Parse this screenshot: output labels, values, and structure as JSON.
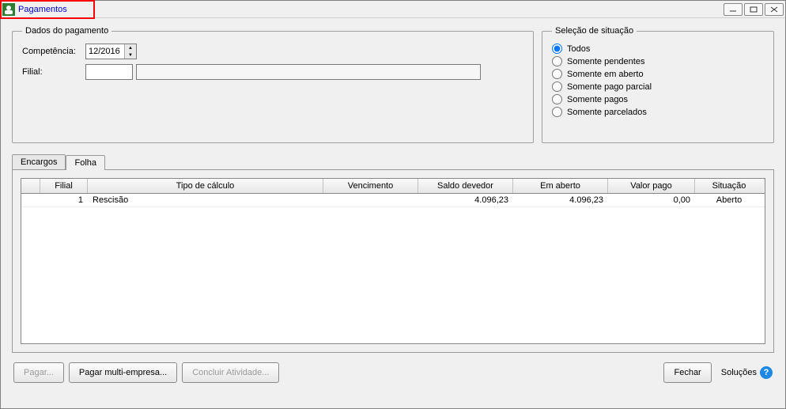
{
  "window": {
    "title": "Pagamentos"
  },
  "fieldset_dados": {
    "legend": "Dados do pagamento",
    "competencia_label": "Competência:",
    "competencia_value": "12/2016",
    "filial_label": "Filial:",
    "filial_code": "",
    "filial_desc": ""
  },
  "fieldset_selecao": {
    "legend": "Seleção de situação",
    "options": [
      "Todos",
      "Somente pendentes",
      "Somente em aberto",
      "Somente pago parcial",
      "Somente pagos",
      "Somente parcelados"
    ],
    "selected_index": 0
  },
  "tabs": {
    "items": [
      "Encargos",
      "Folha"
    ],
    "active_index": 1
  },
  "grid": {
    "headers": {
      "filial": "Filial",
      "tipo": "Tipo de cálculo",
      "vencimento": "Vencimento",
      "saldo": "Saldo devedor",
      "aberto": "Em aberto",
      "pago": "Valor pago",
      "situacao": "Situação"
    },
    "rows": [
      {
        "filial": "1",
        "tipo": "Rescisão",
        "vencimento": "",
        "saldo": "4.096,23",
        "aberto": "4.096,23",
        "pago": "0,00",
        "situacao": "Aberto"
      }
    ]
  },
  "buttons": {
    "pagar": "Pagar...",
    "multi": "Pagar multi-empresa...",
    "concluir": "Concluir Atividade...",
    "fechar": "Fechar",
    "solucoes": "Soluções"
  }
}
